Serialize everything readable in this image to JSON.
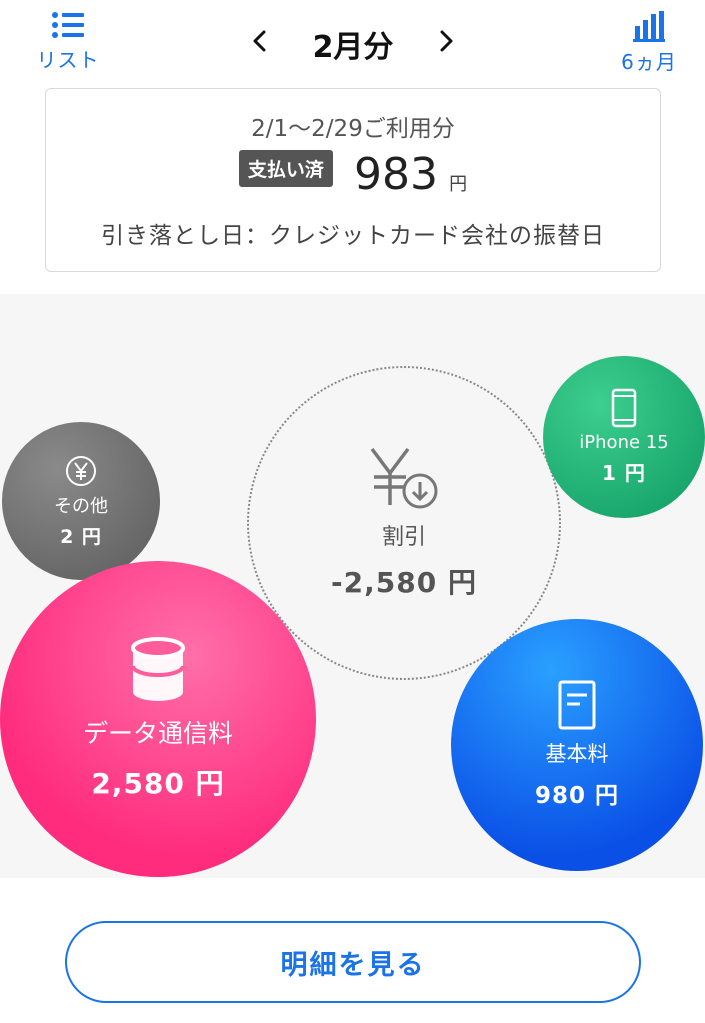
{
  "header": {
    "list_label": "リスト",
    "month_title": "2月分",
    "prev_arrow": "‹",
    "next_arrow": "›",
    "six_month_label": "6ヵ月"
  },
  "summary": {
    "period": "2/1〜2/29ご利用分",
    "status_badge": "支払い済",
    "total_amount": "983",
    "currency_unit": "円",
    "debit_info": "引き落とし日：クレジットカード会社の振替日"
  },
  "bubbles": {
    "other": {
      "icon": "yen-circle-icon",
      "label": "その他",
      "value": "2 円"
    },
    "discount": {
      "icon": "yen-down-icon",
      "label": "割引",
      "value": "-2,580 円"
    },
    "iphone": {
      "icon": "smartphone-icon",
      "label": "iPhone 15",
      "value": "1 円"
    },
    "data": {
      "icon": "database-cylinder-icon",
      "label": "データ通信料",
      "value": "2,580 円"
    },
    "basic": {
      "icon": "document-icon",
      "label": "基本料",
      "value": "980 円"
    }
  },
  "footer": {
    "detail_button": "明細を見る"
  },
  "colors": {
    "accent_blue": "#1a73e8",
    "data_pink": "#ff2b7d",
    "basic_blue": "#0a4fe6",
    "iphone_green": "#0f9a63",
    "other_gray": "#5b5b5b"
  }
}
